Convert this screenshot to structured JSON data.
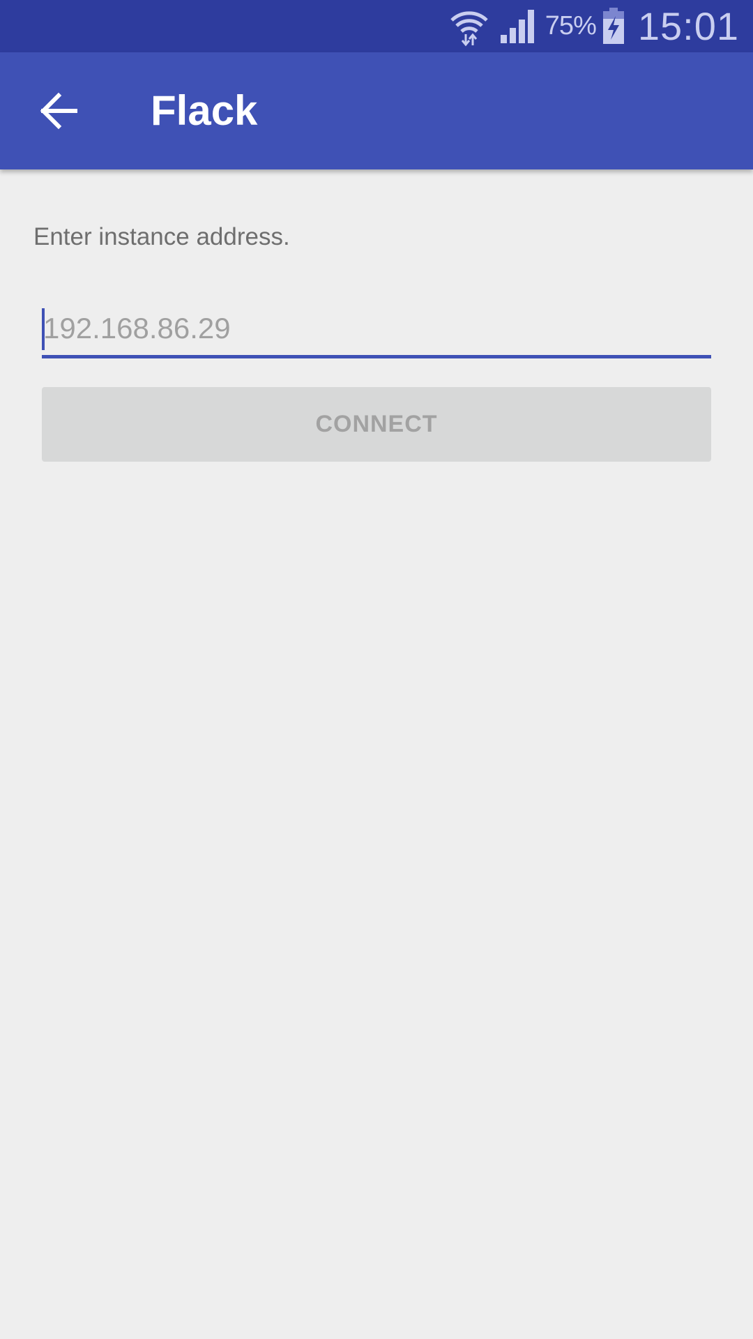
{
  "status_bar": {
    "battery_percent": "75%",
    "time": "15:01"
  },
  "app_bar": {
    "title": "Flack",
    "back_icon": "arrow-back-icon"
  },
  "main": {
    "prompt": "Enter instance address.",
    "address_input": {
      "value": "",
      "placeholder": "192.168.86.29"
    },
    "connect_label": "CONNECT"
  },
  "colors": {
    "primary": "#3F51B5",
    "primary_dark": "#2E3C9E",
    "background": "#EEEEEE",
    "button_disabled": "#D7D8D8"
  }
}
